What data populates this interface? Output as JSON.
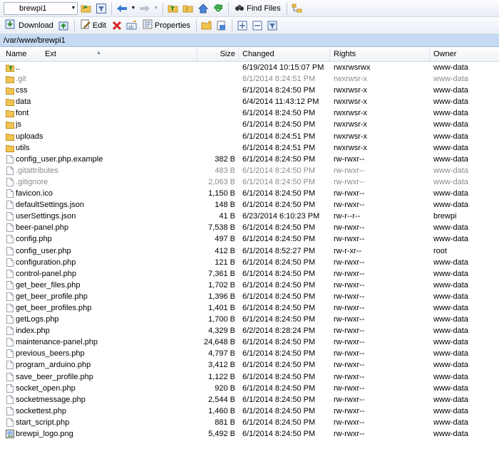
{
  "toolbar1": {
    "location_value": "brewpi1",
    "find_files_label": "Find Files"
  },
  "toolbar2": {
    "download_label": "Download",
    "edit_label": "Edit",
    "properties_label": "Properties"
  },
  "path": "/var/www/brewpi1",
  "columns": {
    "name": "Name",
    "ext": "Ext",
    "size": "Size",
    "changed": "Changed",
    "rights": "Rights",
    "owner": "Owner"
  },
  "files": [
    {
      "name": "..",
      "size": "",
      "changed": "6/19/2014 10:15:07 PM",
      "rights": "rwxrwsrwx",
      "owner": "www-data",
      "type": "parent",
      "dim": false
    },
    {
      "name": ".git",
      "size": "",
      "changed": "6/1/2014 8:24:51 PM",
      "rights": "rwxrwsr-x",
      "owner": "www-data",
      "type": "folder",
      "dim": true
    },
    {
      "name": "css",
      "size": "",
      "changed": "6/1/2014 8:24:50 PM",
      "rights": "rwxrwsr-x",
      "owner": "www-data",
      "type": "folder",
      "dim": false
    },
    {
      "name": "data",
      "size": "",
      "changed": "6/4/2014 11:43:12 PM",
      "rights": "rwxrwsr-x",
      "owner": "www-data",
      "type": "folder",
      "dim": false
    },
    {
      "name": "font",
      "size": "",
      "changed": "6/1/2014 8:24:50 PM",
      "rights": "rwxrwsr-x",
      "owner": "www-data",
      "type": "folder",
      "dim": false
    },
    {
      "name": "js",
      "size": "",
      "changed": "6/1/2014 8:24:50 PM",
      "rights": "rwxrwsr-x",
      "owner": "www-data",
      "type": "folder",
      "dim": false
    },
    {
      "name": "uploads",
      "size": "",
      "changed": "6/1/2014 8:24:51 PM",
      "rights": "rwxrwsr-x",
      "owner": "www-data",
      "type": "folder",
      "dim": false
    },
    {
      "name": "utils",
      "size": "",
      "changed": "6/1/2014 8:24:51 PM",
      "rights": "rwxrwsr-x",
      "owner": "www-data",
      "type": "folder",
      "dim": false
    },
    {
      "name": "config_user.php.example",
      "size": "382 B",
      "changed": "6/1/2014 8:24:50 PM",
      "rights": "rw-rwxr--",
      "owner": "www-data",
      "type": "file",
      "dim": false
    },
    {
      "name": ".gitattributes",
      "size": "483 B",
      "changed": "6/1/2014 8:24:50 PM",
      "rights": "rw-rwxr--",
      "owner": "www-data",
      "type": "file",
      "dim": true
    },
    {
      "name": ".gitignore",
      "size": "2,063 B",
      "changed": "6/1/2014 8:24:50 PM",
      "rights": "rw-rwxr--",
      "owner": "www-data",
      "type": "file",
      "dim": true
    },
    {
      "name": "favicon.ico",
      "size": "1,150 B",
      "changed": "6/1/2014 8:24:50 PM",
      "rights": "rw-rwxr--",
      "owner": "www-data",
      "type": "file",
      "dim": false
    },
    {
      "name": "defaultSettings.json",
      "size": "148 B",
      "changed": "6/1/2014 8:24:50 PM",
      "rights": "rw-rwxr--",
      "owner": "www-data",
      "type": "file",
      "dim": false
    },
    {
      "name": "userSettings.json",
      "size": "41 B",
      "changed": "6/23/2014 6:10:23 PM",
      "rights": "rw-r--r--",
      "owner": "brewpi",
      "type": "file",
      "dim": false
    },
    {
      "name": "beer-panel.php",
      "size": "7,538 B",
      "changed": "6/1/2014 8:24:50 PM",
      "rights": "rw-rwxr--",
      "owner": "www-data",
      "type": "file",
      "dim": false
    },
    {
      "name": "config.php",
      "size": "497 B",
      "changed": "6/1/2014 8:24:50 PM",
      "rights": "rw-rwxr--",
      "owner": "www-data",
      "type": "file",
      "dim": false
    },
    {
      "name": "config_user.php",
      "size": "412 B",
      "changed": "6/1/2014 8:52:27 PM",
      "rights": "rw-r-xr--",
      "owner": "root",
      "type": "file",
      "dim": false
    },
    {
      "name": "configuration.php",
      "size": "121 B",
      "changed": "6/1/2014 8:24:50 PM",
      "rights": "rw-rwxr--",
      "owner": "www-data",
      "type": "file",
      "dim": false
    },
    {
      "name": "control-panel.php",
      "size": "7,361 B",
      "changed": "6/1/2014 8:24:50 PM",
      "rights": "rw-rwxr--",
      "owner": "www-data",
      "type": "file",
      "dim": false
    },
    {
      "name": "get_beer_files.php",
      "size": "1,702 B",
      "changed": "6/1/2014 8:24:50 PM",
      "rights": "rw-rwxr--",
      "owner": "www-data",
      "type": "file",
      "dim": false
    },
    {
      "name": "get_beer_profile.php",
      "size": "1,396 B",
      "changed": "6/1/2014 8:24:50 PM",
      "rights": "rw-rwxr--",
      "owner": "www-data",
      "type": "file",
      "dim": false
    },
    {
      "name": "get_beer_profiles.php",
      "size": "1,401 B",
      "changed": "6/1/2014 8:24:50 PM",
      "rights": "rw-rwxr--",
      "owner": "www-data",
      "type": "file",
      "dim": false
    },
    {
      "name": "getLogs.php",
      "size": "1,700 B",
      "changed": "6/1/2014 8:24:50 PM",
      "rights": "rw-rwxr--",
      "owner": "www-data",
      "type": "file",
      "dim": false
    },
    {
      "name": "index.php",
      "size": "4,329 B",
      "changed": "6/2/2014 8:28:24 PM",
      "rights": "rw-rwxr--",
      "owner": "www-data",
      "type": "file",
      "dim": false
    },
    {
      "name": "maintenance-panel.php",
      "size": "24,648 B",
      "changed": "6/1/2014 8:24:50 PM",
      "rights": "rw-rwxr--",
      "owner": "www-data",
      "type": "file",
      "dim": false
    },
    {
      "name": "previous_beers.php",
      "size": "4,797 B",
      "changed": "6/1/2014 8:24:50 PM",
      "rights": "rw-rwxr--",
      "owner": "www-data",
      "type": "file",
      "dim": false
    },
    {
      "name": "program_arduino.php",
      "size": "3,412 B",
      "changed": "6/1/2014 8:24:50 PM",
      "rights": "rw-rwxr--",
      "owner": "www-data",
      "type": "file",
      "dim": false
    },
    {
      "name": "save_beer_profile.php",
      "size": "1,122 B",
      "changed": "6/1/2014 8:24:50 PM",
      "rights": "rw-rwxr--",
      "owner": "www-data",
      "type": "file",
      "dim": false
    },
    {
      "name": "socket_open.php",
      "size": "920 B",
      "changed": "6/1/2014 8:24:50 PM",
      "rights": "rw-rwxr--",
      "owner": "www-data",
      "type": "file",
      "dim": false
    },
    {
      "name": "socketmessage.php",
      "size": "2,544 B",
      "changed": "6/1/2014 8:24:50 PM",
      "rights": "rw-rwxr--",
      "owner": "www-data",
      "type": "file",
      "dim": false
    },
    {
      "name": "sockettest.php",
      "size": "1,460 B",
      "changed": "6/1/2014 8:24:50 PM",
      "rights": "rw-rwxr--",
      "owner": "www-data",
      "type": "file",
      "dim": false
    },
    {
      "name": "start_script.php",
      "size": "881 B",
      "changed": "6/1/2014 8:24:50 PM",
      "rights": "rw-rwxr--",
      "owner": "www-data",
      "type": "file",
      "dim": false
    },
    {
      "name": "brewpi_logo.png",
      "size": "5,492 B",
      "changed": "6/1/2014 8:24:50 PM",
      "rights": "rw-rwxr--",
      "owner": "www-data",
      "type": "image",
      "dim": false
    }
  ]
}
